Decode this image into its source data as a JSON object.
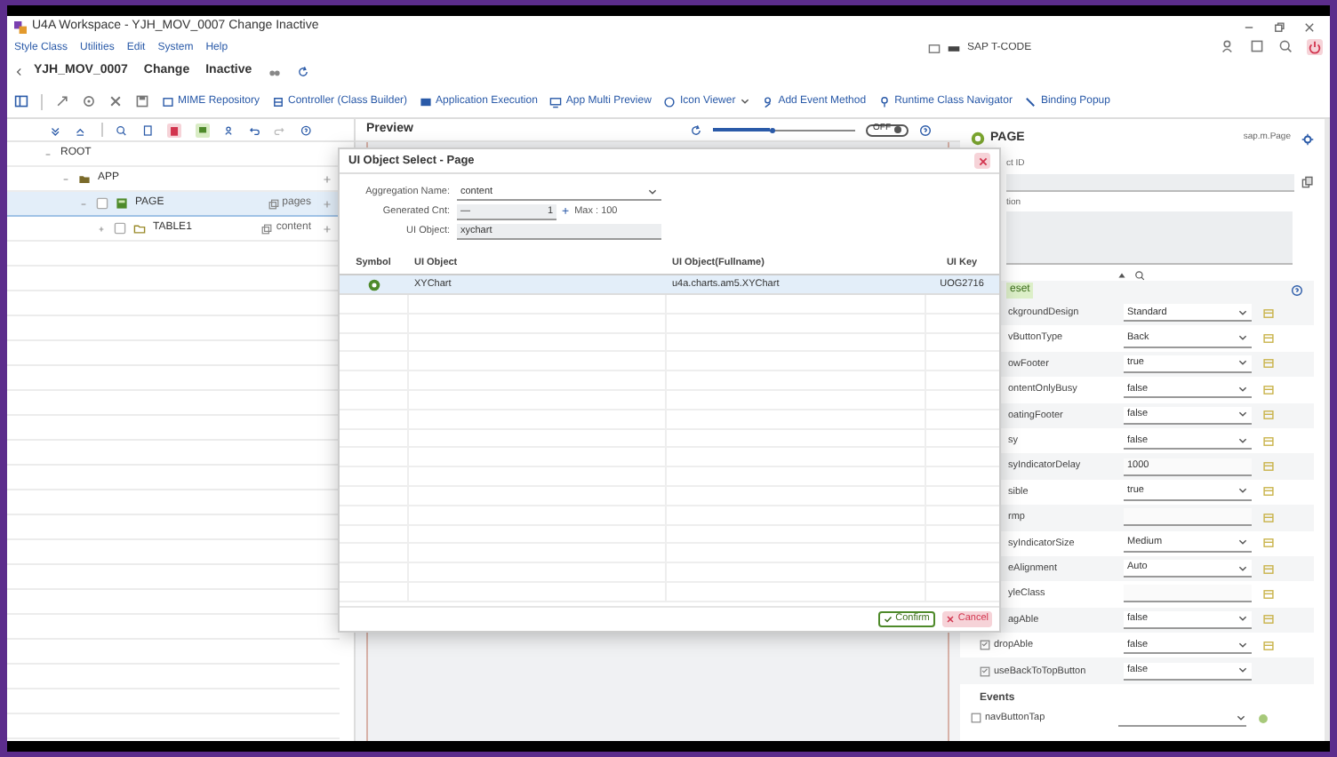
{
  "window": {
    "title": "U4A Workspace - YJH_MOV_0007 Change Inactive"
  },
  "menu": [
    "Style Class",
    "Utilities",
    "Edit",
    "System",
    "Help"
  ],
  "tcode": {
    "placeholder": "SAP T-CODE"
  },
  "header": {
    "program": "YJH_MOV_0007",
    "mode": "Change",
    "status": "Inactive"
  },
  "toolbar": [
    "MIME Repository",
    "Controller (Class Builder)",
    "Application Execution",
    "App Multi Preview",
    "Icon Viewer",
    "Add Event Method",
    "Runtime Class Navigator",
    "Binding Popup"
  ],
  "tree": [
    {
      "label": "ROOT",
      "expanded": true,
      "selected": false,
      "children": [
        {
          "label": "APP",
          "kind": "app",
          "expanded": true,
          "selected": false,
          "children": [
            {
              "label": "PAGE",
              "kind": "page",
              "aggregation": "pages",
              "expanded": true,
              "checked": false,
              "selected": true,
              "children": [
                {
                  "label": "TABLE1",
                  "kind": "table",
                  "aggregation": "content",
                  "expanded": false,
                  "checked": false,
                  "selected": false
                }
              ]
            }
          ]
        }
      ]
    }
  ],
  "preview": {
    "title": "Preview",
    "level": 0.4,
    "toggle": "OFF",
    "on": false
  },
  "properties": {
    "title": "PAGE",
    "class": "sap.m.Page",
    "id_label": "ct ID",
    "description_label": "tion",
    "badge": "eset",
    "rows": [
      {
        "kind": "select",
        "label": "ckgroundDesign",
        "value": "Standard",
        "binding": true
      },
      {
        "kind": "select",
        "label": "vButtonType",
        "value": "Back",
        "binding": true
      },
      {
        "kind": "select",
        "label": "owFooter",
        "value": "true",
        "binding": true
      },
      {
        "kind": "select",
        "label": "ontentOnlyBusy",
        "value": "false",
        "binding": true
      },
      {
        "kind": "select",
        "label": "oatingFooter",
        "value": "false",
        "binding": true
      },
      {
        "kind": "select",
        "label": "sy",
        "value": "false",
        "binding": true
      },
      {
        "kind": "input",
        "label": "syIndicatorDelay",
        "value": "1000",
        "binding": true
      },
      {
        "kind": "select",
        "label": "sible",
        "value": "true",
        "binding": true
      },
      {
        "kind": "input",
        "label": "rmp",
        "binding": true
      },
      {
        "kind": "select",
        "label": "syIndicatorSize",
        "value": "Medium",
        "binding": true
      },
      {
        "kind": "select",
        "label": "eAlignment",
        "value": "Auto",
        "binding": true
      },
      {
        "kind": "input",
        "label": "yleClass",
        "binding": true
      },
      {
        "kind": "select",
        "label": "agAble",
        "value": "false",
        "binding": true
      },
      {
        "kind": "check_select",
        "label": "dropAble",
        "value": "false",
        "binding": true
      },
      {
        "kind": "check_select",
        "label": "useBackToTopButton",
        "value": "false",
        "binding": false
      }
    ],
    "events_title": "Events",
    "events": [
      {
        "label": "navButtonTap",
        "checked": false
      }
    ]
  },
  "dialog": {
    "title": "UI Object Select - Page",
    "aggregation_label": "Aggregation Name:",
    "aggregation": "content",
    "count_label": "Generated Cnt:",
    "minus": "—",
    "count": "1",
    "plus": "+",
    "max": "Max : 100",
    "object_label": "UI Object:",
    "object": "xychart",
    "columns": [
      "Symbol",
      "UI Object",
      "UI Object(Fullname)",
      "UI Key"
    ],
    "rows": [
      {
        "ui_object": "XYChart",
        "fullname": "u4a.charts.am5.XYChart",
        "key": "UOG2716",
        "selected": true
      }
    ],
    "buttons": [
      "Confirm",
      "Cancel"
    ]
  }
}
